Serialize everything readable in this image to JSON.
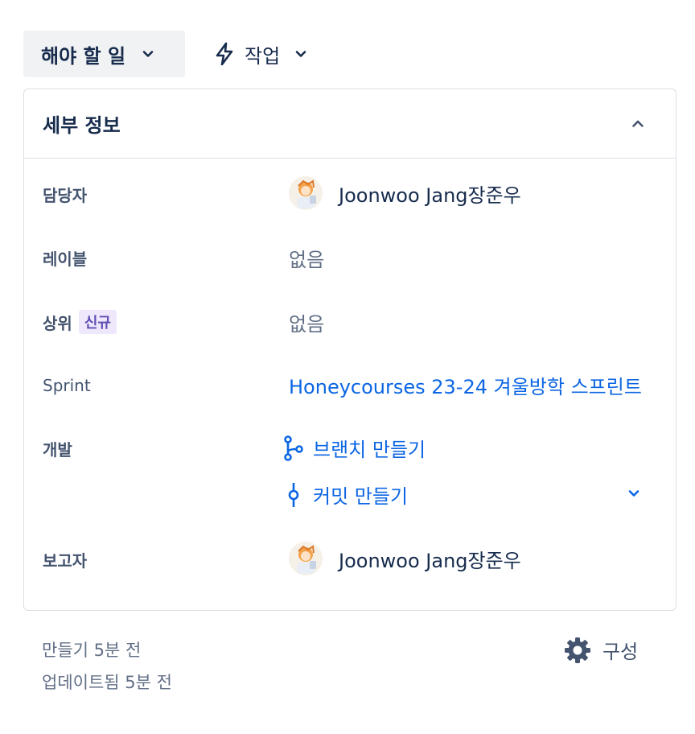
{
  "status": {
    "label": "해야 할 일",
    "icon": "chevron-down-icon"
  },
  "action": {
    "label": "작업",
    "icon": "lightning-bolt-icon"
  },
  "details": {
    "title": "세부 정보",
    "fields": {
      "assignee": {
        "label": "담당자",
        "value": "Joonwoo Jang장준우"
      },
      "labels": {
        "label": "레이블",
        "value": "없음"
      },
      "parent": {
        "label": "상위",
        "badge": "신규",
        "value": "없음"
      },
      "sprint": {
        "label": "Sprint",
        "value": "Honeycourses 23-24 겨울방학 스프린트"
      },
      "development": {
        "label": "개발",
        "create_branch": "브랜치 만들기",
        "create_commit": "커밋 만들기"
      },
      "reporter": {
        "label": "보고자",
        "value": "Joonwoo Jang장준우"
      }
    }
  },
  "footer": {
    "created": "만들기 5분 전",
    "updated": "업데이트됨 5분 전",
    "configure": "구성"
  },
  "colors": {
    "link": "#0c66e4",
    "text": "#172b4d",
    "muted": "#626f86",
    "badge_bg": "#efe8fd",
    "badge_text": "#5e4db2"
  }
}
